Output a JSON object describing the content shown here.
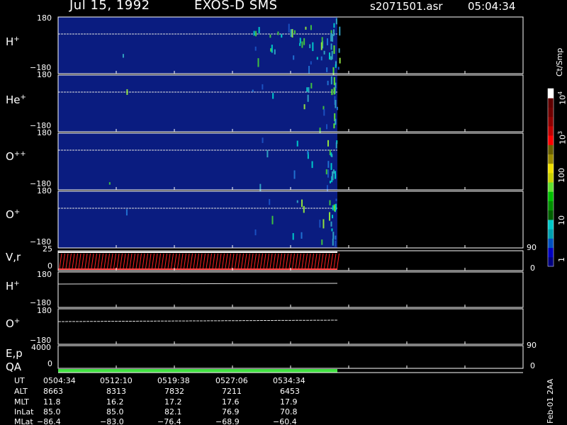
{
  "header": {
    "date": "Jul 15, 1992",
    "instrument": "EXOS-D SMS",
    "file": "s2071501.asr",
    "time": "05:04:34"
  },
  "colorbar": {
    "units": "Ct/Smp",
    "tick_labels": [
      "1",
      "10",
      "100",
      "10",
      "10"
    ],
    "tick_exponents": [
      "",
      "",
      "",
      "3",
      "4"
    ],
    "colors": [
      "#000080",
      "#0000c0",
      "#0050c0",
      "#00a0b0",
      "#00c8c8",
      "#006000",
      "#009000",
      "#00c000",
      "#60e030",
      "#c8d000",
      "#f0e000",
      "#9a8a00",
      "#6a6000",
      "#ff0000",
      "#c00000",
      "#900000",
      "#700000",
      "#600000",
      "#ffffff"
    ]
  },
  "panels": [
    {
      "label": "H",
      "charge": "+",
      "top_tick": "180",
      "bottom_tick": "−180"
    },
    {
      "label": "He",
      "charge": "+",
      "top_tick": "180",
      "bottom_tick": "−180"
    },
    {
      "label": "O",
      "charge": "++",
      "top_tick": "180",
      "bottom_tick": "−180"
    },
    {
      "label": "O",
      "charge": "+",
      "top_tick": "180",
      "bottom_tick": "−180"
    }
  ],
  "vr_panel": {
    "label": "V,r",
    "left_top": "25",
    "left_bottom": "0",
    "right_top": "90",
    "right_bottom": "0"
  },
  "h_line_panel": {
    "label": "H",
    "charge": "+",
    "top_tick": "180",
    "bottom_tick": "−180"
  },
  "o_line_panel": {
    "label": "O",
    "charge": "+",
    "top_tick": "180",
    "bottom_tick": "−180"
  },
  "ep_panel": {
    "label": "E,p",
    "left_top": "4000",
    "left_bottom": "0",
    "right_top": "90",
    "right_bottom": "0"
  },
  "qa_label": "QA",
  "table": {
    "row_labels": [
      "UT",
      "ALT",
      "MLT",
      "InLat",
      "MLat"
    ],
    "columns": [
      [
        "0504:34",
        "8663",
        "11.8",
        "85.0",
        "−86.4"
      ],
      [
        "0512:10",
        "8313",
        "16.2",
        "85.0",
        "−83.0"
      ],
      [
        "0519:38",
        "7832",
        "17.2",
        "82.1",
        "−76.4"
      ],
      [
        "0527:06",
        "7211",
        "17.6",
        "76.9",
        "−68.9"
      ],
      [
        "0534:34",
        "6453",
        "17.9",
        "70.8",
        "−60.4"
      ]
    ]
  },
  "footer_note": "Feb-01 2AA",
  "chart_data": {
    "type": "heatmap",
    "x": [
      "0504:34",
      "0512:10",
      "0519:38",
      "0527:06",
      "0534:34"
    ],
    "series": [
      {
        "name": "H+",
        "ylim": [
          -180,
          180
        ]
      },
      {
        "name": "He+",
        "ylim": [
          -180,
          180
        ]
      },
      {
        "name": "O++",
        "ylim": [
          -180,
          180
        ]
      },
      {
        "name": "O+",
        "ylim": [
          -180,
          180
        ]
      }
    ],
    "colorbar_range": [
      1,
      10000
    ],
    "colorbar_scale": "log",
    "data_end": "0538:00"
  }
}
